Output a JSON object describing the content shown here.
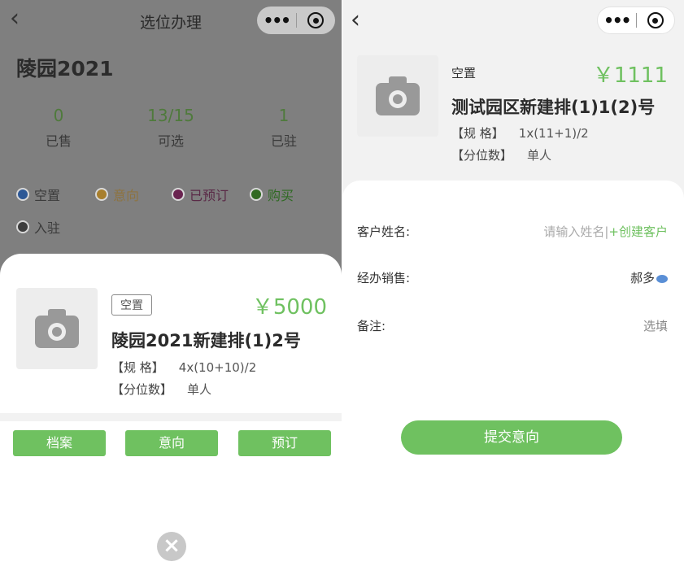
{
  "left": {
    "nav": {
      "back_icon": "chevron-left",
      "title": "选位办理",
      "more_icon": "•••"
    },
    "cemetery": "陵园2021",
    "stats": [
      {
        "value": "0",
        "label": "已售"
      },
      {
        "value": "13",
        "total": "/15",
        "label": "可选"
      },
      {
        "value": "1",
        "label": "已驻"
      }
    ],
    "legend": [
      {
        "label": "空置",
        "color": "#2d5896"
      },
      {
        "label": "意向",
        "color": "#a87f2d"
      },
      {
        "label": "已预订",
        "color": "#6a2450"
      },
      {
        "label": "购买",
        "color": "#316a22"
      },
      {
        "label": "入驻",
        "color": "#3e3e3e"
      }
    ],
    "plot": {
      "status": "空置",
      "price": "￥5000",
      "name": "陵园2021新建排(1)2号",
      "spec_label": "【规 格】",
      "spec_value": "4x(10+10)/2",
      "count_label": "【分位数】",
      "count_value": "单人"
    },
    "buttons": {
      "archive": "档案",
      "intent": "意向",
      "reserve": "预订"
    },
    "close": "×"
  },
  "right": {
    "nav": {
      "back_icon": "chevron-left",
      "more_icon": "•••"
    },
    "plot": {
      "status": "空置",
      "price": "￥1111",
      "name": "测试园区新建排(1)1(2)号",
      "spec_label": "【规 格】",
      "spec_value": "1x(11+1)/2",
      "count_label": "【分位数】",
      "count_value": "单人"
    },
    "form": {
      "customer_label": "客户姓名:",
      "customer_placeholder": "请输入姓名",
      "customer_sep": "|",
      "customer_create": "+创建客户",
      "sales_label": "经办销售:",
      "sales_value": "郝多",
      "remark_label": "备注:",
      "remark_value": "选填"
    },
    "submit": "提交意向"
  },
  "colors": {
    "accent": "#6fc160",
    "overlay": "#7f7f7f"
  }
}
